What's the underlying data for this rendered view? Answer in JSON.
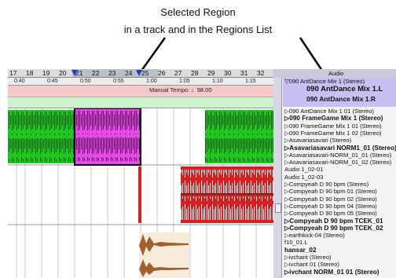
{
  "annotation": {
    "line1": "Selected Region",
    "line2": "in a track and in the Regions List"
  },
  "bar_ruler": [
    "17",
    "18",
    "19",
    "20",
    "21",
    "22",
    "23",
    "24",
    "25",
    "26",
    "27",
    "28",
    "29",
    "30",
    "31",
    "32"
  ],
  "time_ruler": [
    "0:40",
    "0:45",
    "0:50",
    "0:55",
    "1:00",
    "1:05",
    "1:10",
    "1:15"
  ],
  "tempo": {
    "label": "Manual Tempo: ♩98.00"
  },
  "regions_list": {
    "header": "Audio",
    "selected": {
      "line1": "▽090 AntDance Mix 1 (Stereo)",
      "line2": "090 AntDance Mix 1.L",
      "line3": "090 AntDance Mix 1.R"
    },
    "items": [
      {
        "text": "▷090 AntDance Mix 1 01 (Stereo)",
        "bold": false
      },
      {
        "text": "▷090 FrameGame Mix 1 (Stereo)",
        "bold": true
      },
      {
        "text": "▷090 FrameGame Mix 1 01 (Stereo)",
        "bold": false
      },
      {
        "text": "▷090 FrameGame Mix 1 02 (Stereo)",
        "bold": false
      },
      {
        "text": "▷Asavariasavari (Stereo)",
        "bold": false
      },
      {
        "text": "▷Asavariasavari NORM1_01 (Stereo)",
        "bold": true
      },
      {
        "text": "▷Asavariasavari-NORM_01_01 (Stereo)",
        "bold": false
      },
      {
        "text": "▷Asavariasavari-NORM_01_02 (Stereo)",
        "bold": false
      },
      {
        "text": "Audio 1_02-01",
        "bold": false
      },
      {
        "text": "Audio 1_02-03",
        "bold": false
      },
      {
        "text": "▷Compyeah D 90 bpm (Stereo)",
        "bold": false
      },
      {
        "text": "▷Compyeah D 90 bpm 01 (Stereo)",
        "bold": false
      },
      {
        "text": "▷Compyeah D 90 bpm 02 (Stereo)",
        "bold": false
      },
      {
        "text": "▷Compyeah D 90 bpm 04 (Stereo)",
        "bold": false
      },
      {
        "text": "▷Compyeah D 90 bpm 05 (Stereo)",
        "bold": false
      },
      {
        "text": "▷Compyeah D 90 bpm TCEK_01",
        "bold": true
      },
      {
        "text": "▷Compyeah D 90 bpm TCEK_02",
        "bold": true
      },
      {
        "text": "▷earthkick-04 (Stereo)",
        "bold": false
      },
      {
        "text": "f10_01.L",
        "bold": false
      },
      {
        "text": "hansar_02",
        "bold": true
      },
      {
        "text": "▷ivchant (Stereo)",
        "bold": false
      },
      {
        "text": "▷ivchant 01 (Stereo)",
        "bold": false
      },
      {
        "text": "▷ivchant NORM_01 01 (Stereo)",
        "bold": true
      }
    ]
  },
  "colors": {
    "green_region": "#1ec81e",
    "selected_region": "#e64ae6",
    "red_region": "#d81e1e",
    "brown_region": "#a06030",
    "selection_highlight": "#c8bff3"
  }
}
